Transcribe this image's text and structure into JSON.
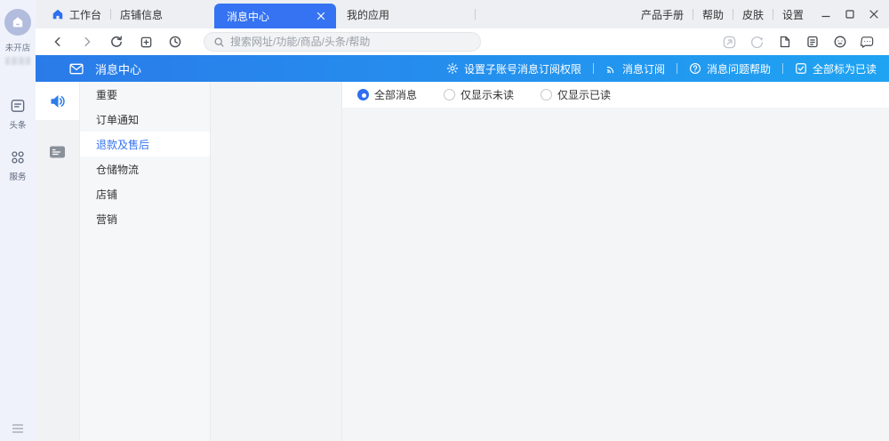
{
  "colors": {
    "accent": "#3573f2",
    "bluebar_gradient_start": "#2a7be9",
    "bluebar_gradient_end": "#1fa3f2",
    "rail_bg": "#eff2fb",
    "titlebar_bg": "#edeff2"
  },
  "left_rail": {
    "shop_status": "未开店",
    "nav": [
      {
        "label": "头条"
      },
      {
        "label": "服务"
      }
    ]
  },
  "titlebar": {
    "workbench": "工作台",
    "shop_info": "店铺信息",
    "active_tab": "消息中心",
    "my_apps": "我的应用",
    "menu": {
      "product_manual": "产品手册",
      "help": "帮助",
      "skin": "皮肤",
      "settings": "设置"
    }
  },
  "navbar": {
    "search_placeholder": "搜索网址/功能/商品/头条/帮助"
  },
  "bluebar": {
    "title": "消息中心",
    "actions": {
      "sub_account": "设置子账号消息订阅权限",
      "subscribe": "消息订阅",
      "msg_help": "消息问题帮助",
      "mark_all_read": "全部标为已读"
    }
  },
  "message_menu": {
    "items": [
      "重要",
      "订单通知",
      "退款及售后",
      "仓储物流",
      "店铺",
      "营销"
    ],
    "selected": "退款及售后"
  },
  "filters": {
    "all": "全部消息",
    "unread": "仅显示未读",
    "read": "仅显示已读",
    "selected": "全部消息"
  }
}
